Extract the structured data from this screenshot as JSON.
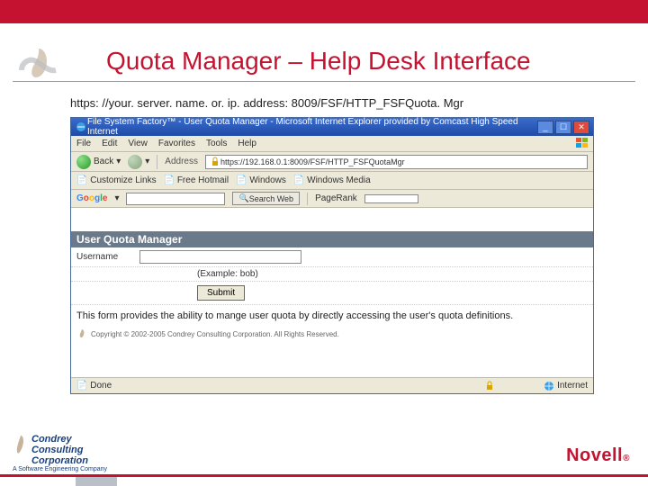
{
  "header": {
    "title": "Quota Manager – Help Desk Interface"
  },
  "url_line": "https: //your. server. name. or. ip. address: 8009/FSF/HTTP_FSFQuota. Mgr",
  "ie": {
    "title": "File System Factory™ - User Quota Manager - Microsoft Internet Explorer provided by Comcast High Speed Internet",
    "menu": {
      "file": "File",
      "edit": "Edit",
      "view": "View",
      "favorites": "Favorites",
      "tools": "Tools",
      "help": "Help"
    },
    "toolbar": {
      "back": "Back",
      "address_label": "Address",
      "address_value": "https://192.168.0.1:8009/FSF/HTTP_FSFQuotaMgr"
    },
    "toolbar2": {
      "item1": "Customize Links",
      "item2": "Free Hotmail",
      "item3": "Windows",
      "item4": "Windows Media"
    },
    "toolbar3": {
      "google": "Google",
      "search_btn": "Search Web",
      "pagerank": "PageRank"
    },
    "content": {
      "header": "User Quota Manager",
      "username_label": "Username",
      "example": "(Example: bob)",
      "submit": "Submit",
      "description": "This form provides the ability to mange user quota by directly accessing the user's quota definitions.",
      "copyright": "Copyright © 2002-2005 Condrey Consulting Corporation. All Rights Reserved."
    },
    "status": {
      "done": "Done",
      "zone": "Internet"
    }
  },
  "footer": {
    "condrey": {
      "l1": "Condrey",
      "l2": "Consulting",
      "l3": "Corporation",
      "tag": "A Software Engineering Company"
    },
    "novell": "Novell"
  }
}
